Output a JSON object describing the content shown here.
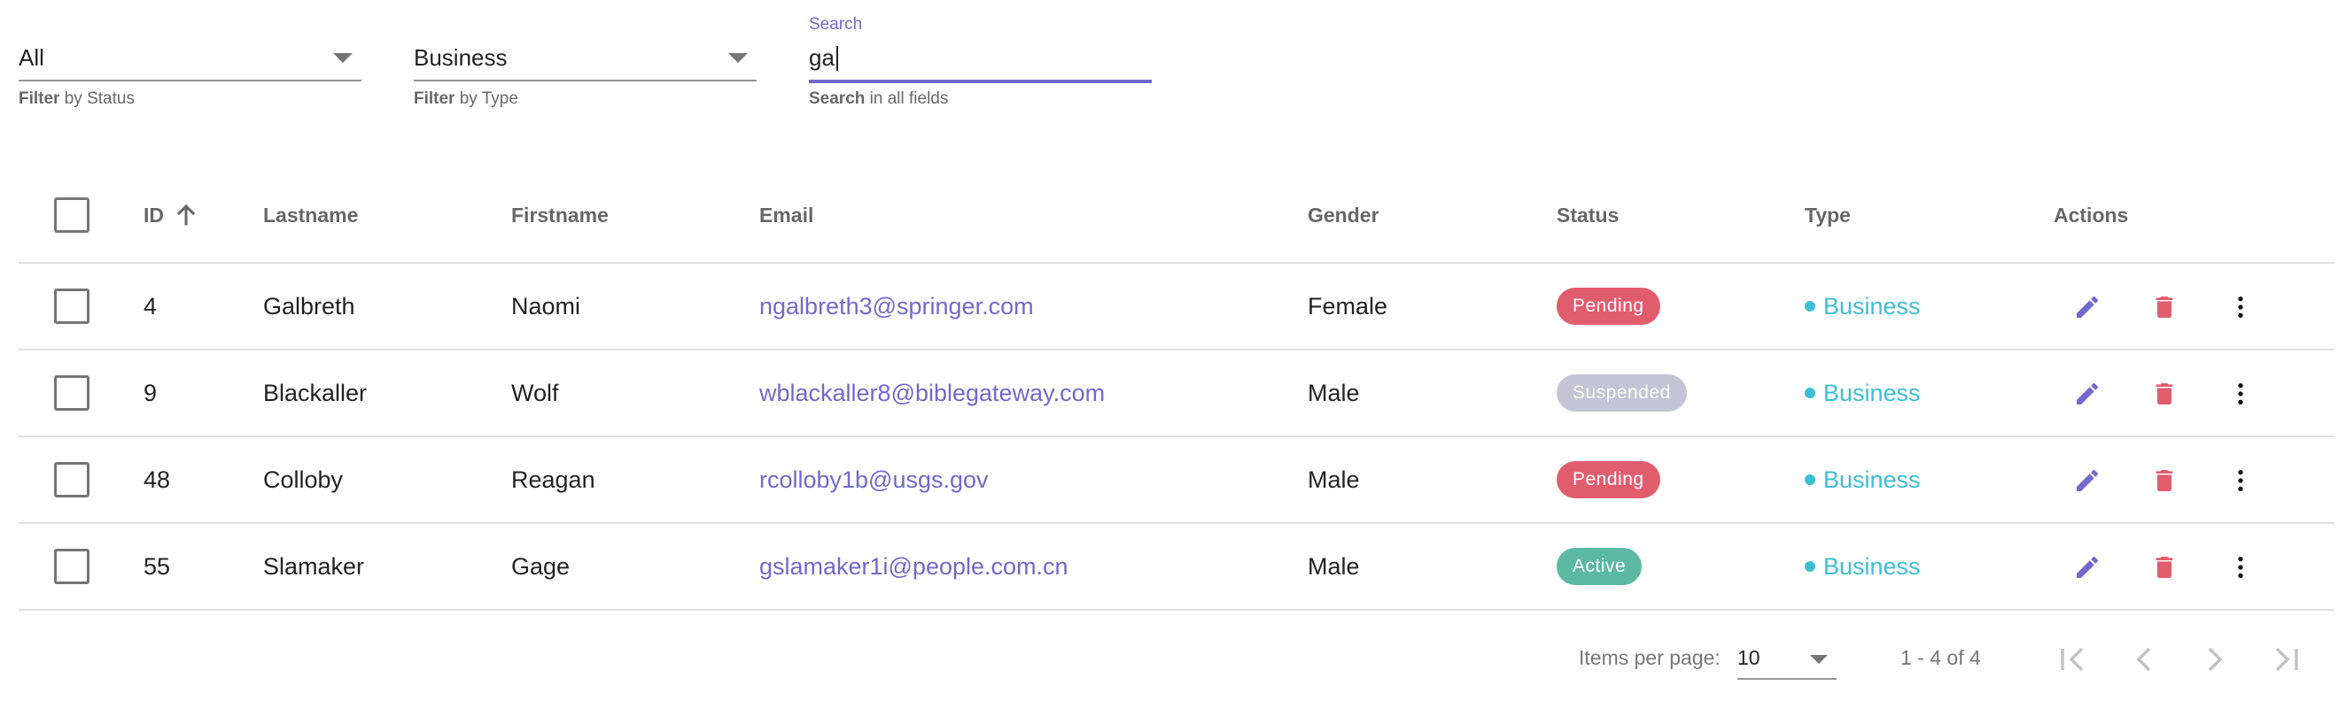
{
  "filters": {
    "status": {
      "value": "All",
      "hint_bold": "Filter",
      "hint_rest": " by Status"
    },
    "type": {
      "value": "Business",
      "hint_bold": "Filter",
      "hint_rest": " by Type"
    },
    "search": {
      "label": "Search",
      "value": "ga",
      "hint_bold": "Search",
      "hint_rest": " in all fields"
    }
  },
  "table": {
    "columns": {
      "id": "ID",
      "lastname": "Lastname",
      "firstname": "Firstname",
      "email": "Email",
      "gender": "Gender",
      "status": "Status",
      "type": "Type",
      "actions": "Actions"
    },
    "rows": [
      {
        "id": "4",
        "lastname": "Galbreth",
        "firstname": "Naomi",
        "email": "ngalbreth3@springer.com",
        "gender": "Female",
        "status": "Pending",
        "type": "Business"
      },
      {
        "id": "9",
        "lastname": "Blackaller",
        "firstname": "Wolf",
        "email": "wblackaller8@biblegateway.com",
        "gender": "Male",
        "status": "Suspended",
        "type": "Business"
      },
      {
        "id": "48",
        "lastname": "Colloby",
        "firstname": "Reagan",
        "email": "rcolloby1b@usgs.gov",
        "gender": "Male",
        "status": "Pending",
        "type": "Business"
      },
      {
        "id": "55",
        "lastname": "Slamaker",
        "firstname": "Gage",
        "email": "gslamaker1i@people.com.cn",
        "gender": "Male",
        "status": "Active",
        "type": "Business"
      }
    ]
  },
  "paginator": {
    "items_per_page_label": "Items per page:",
    "page_size": "10",
    "range": "1 - 4 of 4"
  },
  "colors": {
    "accent": "#7268cd",
    "pending": "#e15d6e",
    "suspended": "#c4c4d4",
    "active": "#5ab9a0",
    "business": "#3cbfd4",
    "delete": "#e15d6e"
  },
  "icons": {
    "sort": "arrow-up-icon",
    "edit": "pencil-icon",
    "delete": "trash-icon",
    "more": "more-vertical-icon",
    "first": "first-page-icon",
    "prev": "chevron-left-icon",
    "next": "chevron-right-icon",
    "last": "last-page-icon"
  }
}
